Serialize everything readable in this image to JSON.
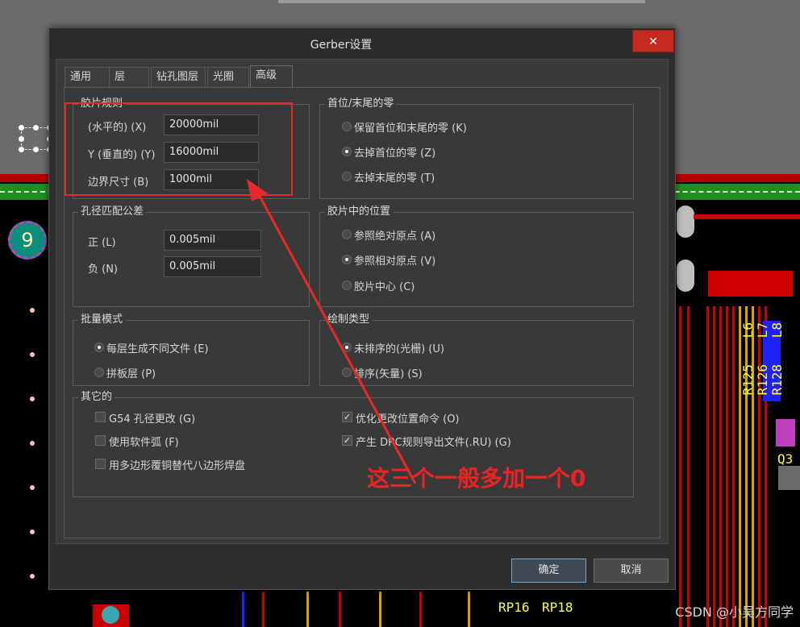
{
  "dialog": {
    "title": "Gerber设置",
    "close_label": "✕",
    "tabs": [
      "通用",
      "层",
      "钻孔图层",
      "光圈",
      "高级"
    ],
    "active_tab": "高级",
    "film_rules": {
      "title": "胶片规则",
      "x_label": "(水平的) (X)",
      "x_value": "20000mil",
      "y_label": "Y (垂直的) (Y)",
      "y_value": "16000mil",
      "border_label": "边界尺寸 (B)",
      "border_value": "1000mil"
    },
    "leading_trailing_zeros": {
      "title": "首位/末尾的零",
      "options": [
        "保留首位和末尾的零 (K)",
        "去掉首位的零 (Z)",
        "去掉末尾的零 (T)"
      ],
      "selected": "去掉首位的零 (Z)"
    },
    "aperture_tolerance": {
      "title": "孔径匹配公差",
      "plus_label": "正 (L)",
      "plus_value": "0.005mil",
      "minus_label": "负 (N)",
      "minus_value": "0.005mil"
    },
    "position_on_film": {
      "title": "胶片中的位置",
      "options": [
        "参照绝对原点 (A)",
        "参照相对原点 (V)",
        "胶片中心 (C)"
      ],
      "selected": "参照相对原点 (V)"
    },
    "batch_mode": {
      "title": "批量模式",
      "options": [
        "每层生成不同文件 (E)",
        "拼板层 (P)"
      ],
      "selected": "每层生成不同文件 (E)"
    },
    "plotter_type": {
      "title": "绘制类型",
      "options": [
        "未排序的(光栅) (U)",
        "排序(矢量) (S)"
      ],
      "selected": "未排序的(光栅) (U)"
    },
    "other": {
      "title": "其它的",
      "checkboxes": [
        {
          "label": "G54 孔径更改 (G)",
          "checked": false
        },
        {
          "label": "使用软件弧 (F)",
          "checked": false
        },
        {
          "label": "用多边形覆铜替代八边形焊盘",
          "checked": false
        },
        {
          "label": "优化更改位置命令 (O)",
          "checked": true
        },
        {
          "label": "产生 DRC规则导出文件(.RU) (G)",
          "checked": true
        }
      ]
    },
    "ok_label": "确定",
    "cancel_label": "取消"
  },
  "annotation": {
    "text": "这三个一般多加一个0",
    "color": "#ee2222"
  },
  "pcb": {
    "pad_label": "9",
    "labels": [
      "L6",
      "L7",
      "L8",
      "R125",
      "R126",
      "R128",
      "Q3",
      "RP16",
      "RP18"
    ]
  },
  "watermark": "CSDN @小吴方同学",
  "colors": {
    "dialog_bg": "#2e2e2e",
    "panel_bg": "#393939",
    "close_red": "#c42b1c",
    "pcb_green": "#1f8f22",
    "pcb_red": "#b50000",
    "annotation_red": "#e8282a"
  }
}
